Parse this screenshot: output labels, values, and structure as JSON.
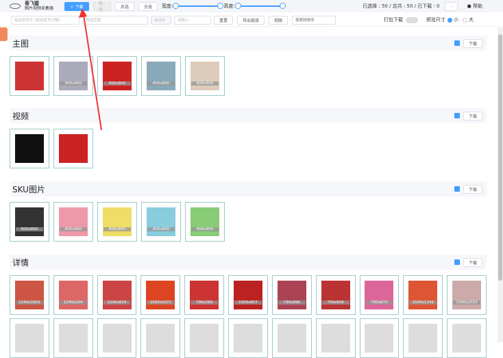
{
  "app": {
    "name": "香飞猩",
    "subtitle": "图片视频采集器"
  },
  "toolbar": {
    "download": "+ 下载",
    "disabled": "删除",
    "invert": "反选",
    "select_all": "全选",
    "width_label": "宽度:",
    "height_label": "高度:",
    "stats": "已选择 : 50 / 总共 : 50 / 已下载 : 0",
    "minus": "-",
    "help": "帮助"
  },
  "filters": {
    "keyword_placeholder": "指向名称字 (使用逗号分隔)",
    "filter_placeholder": "筛选范围",
    "auto_label": "自动出",
    "input_placeholder": "请输入",
    "reset": "重置",
    "export": "导出链接",
    "view": "视图",
    "sort": "按原网排序",
    "pack": "打包下载",
    "preview": "预览尺寸",
    "small": "小",
    "large": "大"
  },
  "sections": [
    {
      "title": "主图",
      "download": "下载",
      "items": [
        {
          "label": "",
          "color": "#c33"
        },
        {
          "label": "800x800",
          "color": "#aab"
        },
        {
          "label": "800x800",
          "color": "#c22"
        },
        {
          "label": "800x800",
          "color": "#8ab"
        },
        {
          "label": "800x800",
          "color": "#dcb"
        }
      ]
    },
    {
      "title": "视频",
      "download": "下载",
      "items": [
        {
          "label": "",
          "color": "#111"
        },
        {
          "label": "",
          "color": "#c22"
        }
      ]
    },
    {
      "title": "SKU图片",
      "download": "下载",
      "items": [
        {
          "label": "800x800",
          "color": "#333"
        },
        {
          "label": "800x800",
          "color": "#e9a"
        },
        {
          "label": "800x800",
          "color": "#ed6"
        },
        {
          "label": "800x800",
          "color": "#8cd"
        },
        {
          "label": "800x800",
          "color": "#8c7"
        }
      ]
    },
    {
      "title": "详情",
      "download": "下载",
      "items": [
        {
          "label": "1240x1920",
          "color": "#c54"
        },
        {
          "label": "1240x204",
          "color": "#d66"
        },
        {
          "label": "1240x624",
          "color": "#c44"
        },
        {
          "label": "1500x1071",
          "color": "#d42"
        },
        {
          "label": "790x269",
          "color": "#c33"
        },
        {
          "label": "1500x807",
          "color": "#b22"
        },
        {
          "label": "790x896",
          "color": "#a45"
        },
        {
          "label": "790x656",
          "color": "#b33"
        },
        {
          "label": "790x673",
          "color": "#d69"
        },
        {
          "label": "1500x1243",
          "color": "#d53"
        },
        {
          "label": "1500x2322",
          "color": "#caa"
        }
      ]
    }
  ]
}
